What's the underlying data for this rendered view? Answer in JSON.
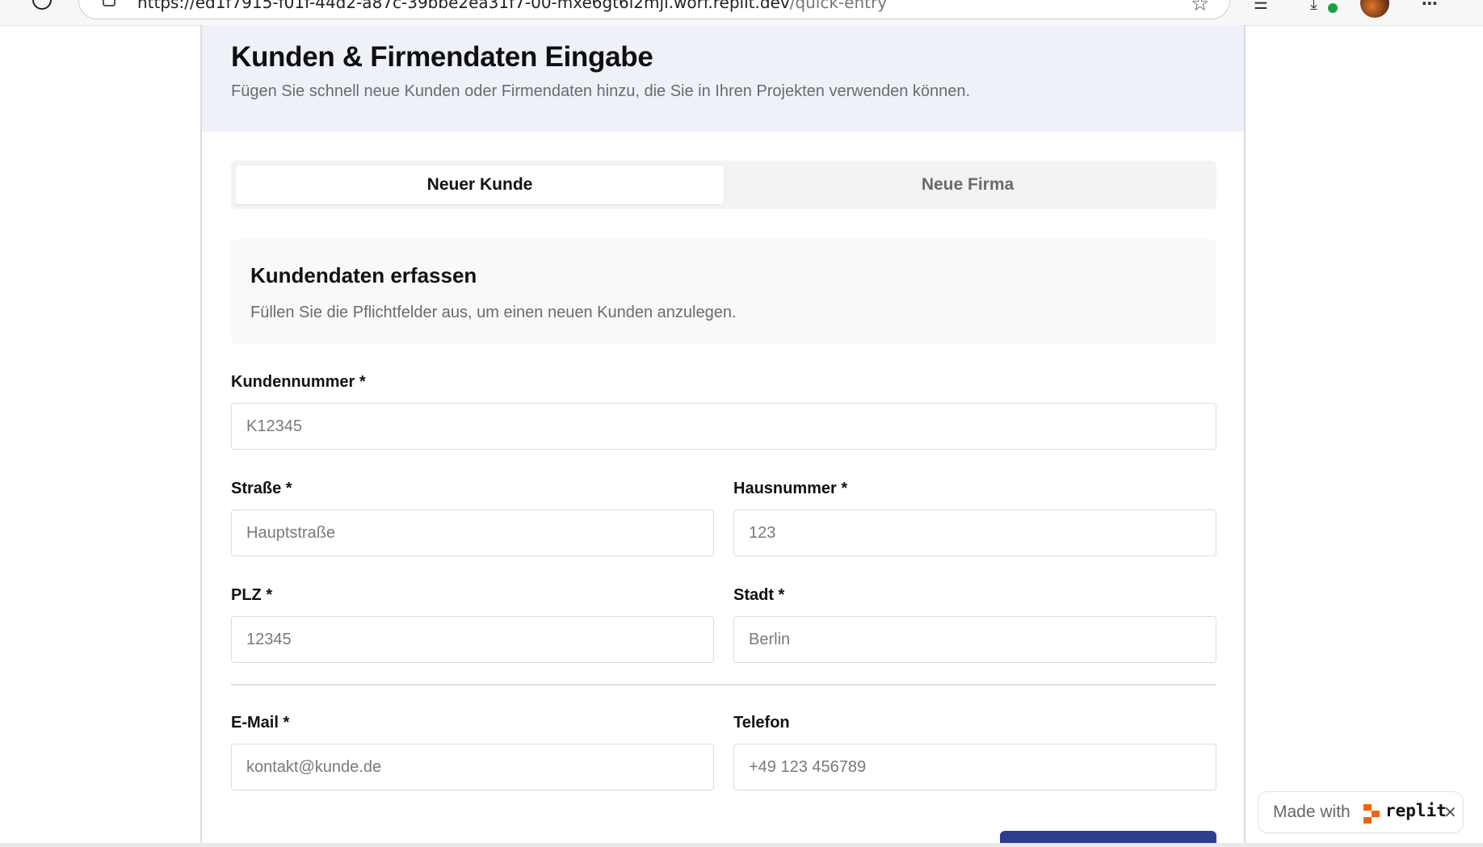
{
  "browser": {
    "url_main": "https://ed1f7915-f01f-44d2-a87c-39bbe2ea31f7-00-mxe6gt6i2mjl.worf.replit.dev",
    "url_path": "/quick-entry",
    "icons": [
      "reload-icon",
      "site-info-icon",
      "star-icon",
      "collections-icon",
      "downloads-icon",
      "profile-avatar",
      "more-icon"
    ]
  },
  "header": {
    "title": "Kunden & Firmendaten Eingabe",
    "subtitle": "Fügen Sie schnell neue Kunden oder Firmendaten hinzu, die Sie in Ihren Projekten verwenden können."
  },
  "tabs": [
    {
      "label": "Neuer Kunde",
      "active": true
    },
    {
      "label": "Neue Firma",
      "active": false
    }
  ],
  "section": {
    "title": "Kundendaten erfassen",
    "subtitle": "Füllen Sie die Pflichtfelder aus, um einen neuen Kunden anzulegen."
  },
  "form": {
    "kundennummer": {
      "label": "Kundennummer *",
      "placeholder": "K12345",
      "value": ""
    },
    "strasse": {
      "label": "Straße *",
      "placeholder": "Hauptstraße",
      "value": ""
    },
    "hausnummer": {
      "label": "Hausnummer *",
      "placeholder": "123",
      "value": ""
    },
    "plz": {
      "label": "PLZ *",
      "placeholder": "12345",
      "value": ""
    },
    "stadt": {
      "label": "Stadt *",
      "placeholder": "Berlin",
      "value": ""
    },
    "email": {
      "label": "E-Mail *",
      "placeholder": "kontakt@kunde.de",
      "value": ""
    },
    "telefon": {
      "label": "Telefon",
      "placeholder": "+49 123 456789",
      "value": ""
    }
  },
  "badge": {
    "made_with": "Made with",
    "brand": "replit",
    "close": "×"
  },
  "colors": {
    "header_bg": "#eff1f9",
    "accent": "#2f3d8f",
    "replit_orange": "#f26207"
  }
}
